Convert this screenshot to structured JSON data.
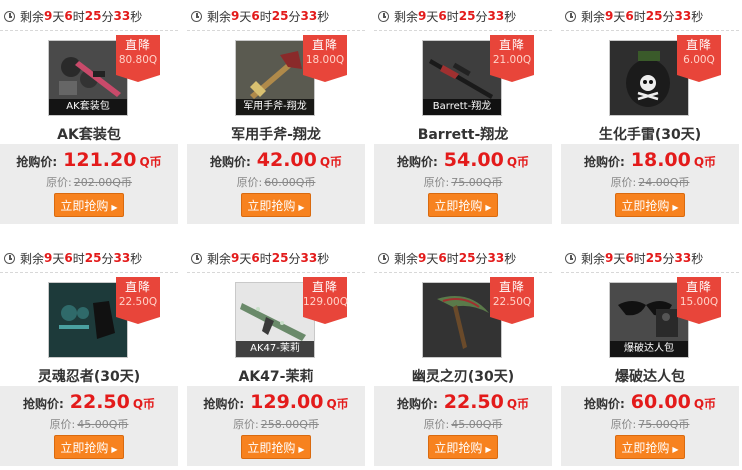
{
  "ui": {
    "timer_prefix": "剩余",
    "day_unit": "天",
    "hour_unit": "时",
    "min_unit": "分",
    "sec_unit": "秒",
    "rush_label": "抢购价:",
    "orig_label": "原价:",
    "buy_label": "立即抢购",
    "buy_arrow": "▶",
    "badge_label": "直降",
    "currency": "Q币"
  },
  "countdown": {
    "days": "9",
    "hours": "6",
    "minutes": "25",
    "seconds": "33"
  },
  "products": [
    {
      "name": "AK套装包",
      "thumb_caption": "AK套装包",
      "drop": "80.80Q",
      "price": "121.20",
      "original": "202.00Q币"
    },
    {
      "name": "军用手斧-翔龙",
      "thumb_caption": "军用手斧-翔龙",
      "drop": "18.00Q",
      "price": "42.00",
      "original": "60.00Q币"
    },
    {
      "name": "Barrett-翔龙",
      "thumb_caption": "Barrett-翔龙",
      "drop": "21.00Q",
      "price": "54.00",
      "original": "75.00Q币"
    },
    {
      "name": "生化手雷(30天)",
      "thumb_caption": "",
      "drop": "6.00Q",
      "price": "18.00",
      "original": "24.00Q币"
    },
    {
      "name": "灵魂忍者(30天)",
      "thumb_caption": "",
      "drop": "22.50Q",
      "price": "22.50",
      "original": "45.00Q币"
    },
    {
      "name": "AK47-茉莉",
      "thumb_caption": "AK47-茉莉",
      "drop": "129.00Q",
      "price": "129.00",
      "original": "258.00Q币"
    },
    {
      "name": "幽灵之刃(30天)",
      "thumb_caption": "",
      "drop": "22.50Q",
      "price": "22.50",
      "original": "45.00Q币"
    },
    {
      "name": "爆破达人包",
      "thumb_caption": "爆破达人包",
      "drop": "15.00Q",
      "price": "60.00",
      "original": "75.00Q币"
    }
  ]
}
